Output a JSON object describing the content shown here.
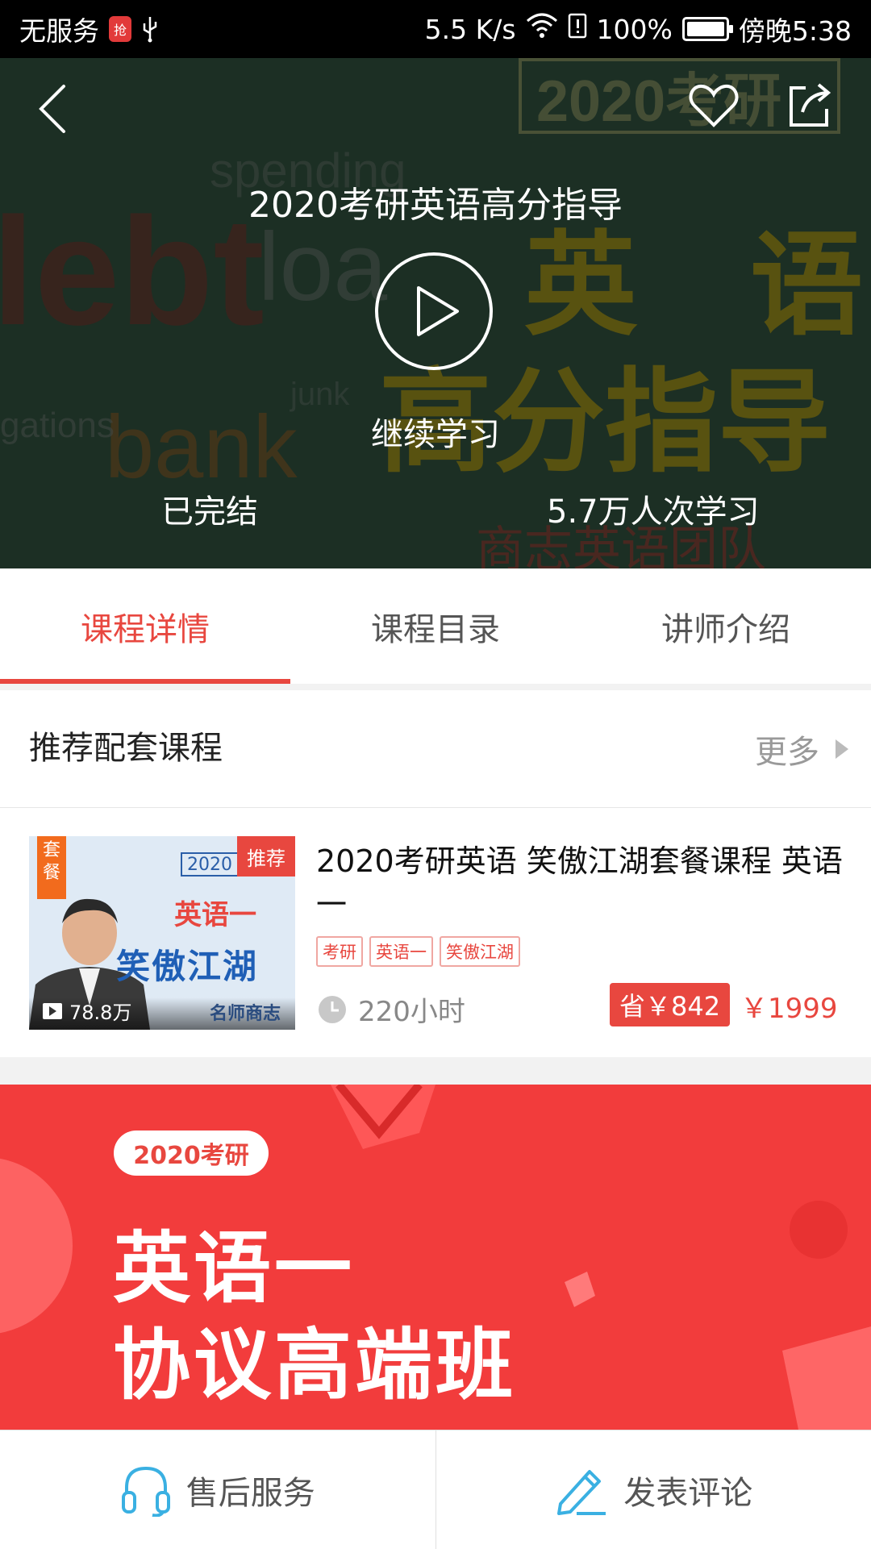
{
  "status_bar": {
    "carrier": "无服务",
    "badge": "抢红包",
    "speed": "5.5 K/s",
    "battery": "100%",
    "time": "傍晚5:38"
  },
  "hero": {
    "title": "2020考研英语高分指导",
    "continue_label": "继续学习",
    "status": "已完结",
    "learners": "5.7万人次学习"
  },
  "tabs": [
    {
      "label": "课程详情",
      "active": true
    },
    {
      "label": "课程目录",
      "active": false
    },
    {
      "label": "讲师介绍",
      "active": false
    }
  ],
  "recommend": {
    "title": "推荐配套课程",
    "more_label": "更多"
  },
  "course": {
    "thumb_tag_left": "套餐",
    "thumb_tag_right": "推荐",
    "thumb_year": "2020",
    "thumb_line1": "英语一",
    "thumb_line2": "笑傲江湖",
    "thumb_views": "78.8万",
    "thumb_teacher": "名师商志",
    "title": "2020考研英语 笑傲江湖套餐课程 英语一",
    "tags": [
      "考研",
      "英语一",
      "笑傲江湖"
    ],
    "duration": "220小时",
    "save": "省￥842",
    "price": "￥1999"
  },
  "banner": {
    "pill": "2020考研",
    "line1": "英语一",
    "line2": "协议高端班"
  },
  "bottom_bar": {
    "service_label": "售后服务",
    "comment_label": "发表评论"
  },
  "colors": {
    "accent": "#e8473f",
    "banner_red": "#f23c3c",
    "icon_blue": "#3ab0e2"
  }
}
